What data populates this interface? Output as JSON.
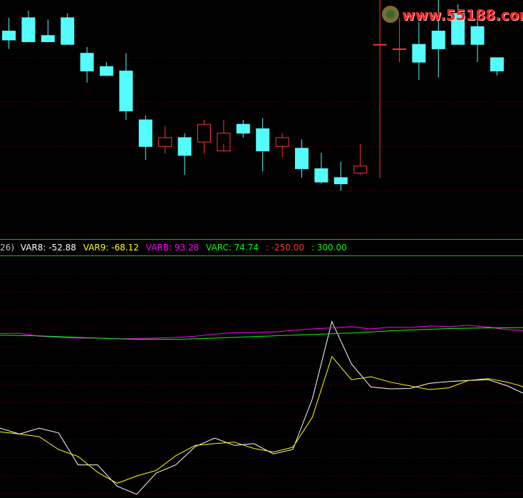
{
  "colors": {
    "background": "#000000",
    "up_candle": "#ff3232",
    "down_candle": "#54fcfc",
    "grid": "#800000",
    "separator": "#00c800",
    "var8": "#ffffff",
    "var9": "#ffff00",
    "varb": "#ff00ff",
    "varc": "#00ff00",
    "level_low": "#ff3232",
    "level_high": "#00ff00"
  },
  "watermark": {
    "text": "www.55188.com",
    "icon": "logo-circle-icon"
  },
  "indicator_bar": {
    "prefix": "26)",
    "var8": "VAR8: -52.88",
    "var9": "VAR9: -68.12",
    "varb": "VARB: 93.28",
    "varc": "VARC: 74.74",
    "level_low": ": -250.00",
    "level_high": ": 300.00"
  },
  "chart_data": [
    {
      "type": "candlestick",
      "title": "",
      "x": [
        0,
        1,
        2,
        3,
        4,
        5,
        6,
        7,
        8,
        9,
        10,
        11,
        12,
        13,
        14,
        15,
        16,
        17,
        18,
        19,
        20,
        21,
        22,
        23,
        24,
        25
      ],
      "open": [
        98,
        99.5,
        97.5,
        99.5,
        95.5,
        94,
        93.5,
        88,
        85,
        86,
        85.5,
        84.5,
        87.5,
        87,
        85,
        84.8,
        82.5,
        81.5,
        82,
        96.5,
        96,
        96.5,
        98,
        100,
        98.5,
        95
      ],
      "high": [
        99.5,
        100.3,
        99.3,
        100,
        96.2,
        94.5,
        95.5,
        88.5,
        87.3,
        86.5,
        88,
        88,
        88,
        88.2,
        86.5,
        85.8,
        84.3,
        83.3,
        85.3,
        102,
        99.5,
        99,
        101.5,
        101,
        100,
        95
      ],
      "low": [
        96,
        96.8,
        96.8,
        96.5,
        92.2,
        93,
        88,
        83.5,
        84.2,
        81.8,
        84.2,
        85.3,
        86,
        82.2,
        83.8,
        81.5,
        80.8,
        80,
        81.8,
        81.4,
        94.5,
        92.5,
        92.8,
        97,
        94.5,
        93
      ],
      "close": [
        97,
        96.8,
        96.8,
        96.5,
        93.5,
        93,
        89,
        85,
        86,
        84,
        87.5,
        86.5,
        86.5,
        84.5,
        86,
        82.5,
        81,
        80.8,
        82.8,
        96.5,
        96,
        94.5,
        96,
        96.5,
        96.5,
        93.5
      ]
    },
    {
      "type": "line",
      "title": "",
      "x": [
        0,
        1,
        2,
        3,
        4,
        5,
        6,
        7,
        8,
        9,
        10,
        11,
        12,
        13,
        14,
        15,
        16,
        17,
        18,
        19,
        20,
        21,
        22,
        23,
        24,
        25,
        26,
        27,
        28
      ],
      "series": [
        {
          "name": "VAR8",
          "values": [
            -170,
            -186,
            -170,
            -183,
            -270,
            -270,
            -328,
            -350,
            -292,
            -270,
            -220,
            -197,
            -217,
            -212,
            -240,
            -228,
            -90,
            120,
            5,
            -58,
            -63,
            -62,
            -48,
            -43,
            -40,
            -38,
            -55,
            -80,
            -90
          ]
        },
        {
          "name": "VAR9",
          "values": [
            -180,
            -186,
            -193,
            -228,
            -247,
            -290,
            -320,
            -300,
            -285,
            -245,
            -217,
            -212,
            -208,
            -225,
            -235,
            -222,
            -140,
            25,
            -38,
            -30,
            -45,
            -55,
            -65,
            -60,
            -40,
            -35,
            -45,
            -60,
            -75
          ]
        },
        {
          "name": "VARB",
          "values": [
            88,
            88,
            80,
            77,
            75,
            75,
            73,
            74,
            75,
            77,
            80,
            86,
            90,
            91,
            92,
            96,
            100,
            103,
            106,
            100,
            105,
            104,
            108,
            106,
            110,
            105,
            98,
            95,
            93
          ]
        },
        {
          "name": "VARC",
          "values": [
            83,
            82,
            81,
            79,
            77,
            75,
            73,
            72,
            72,
            72,
            73,
            75,
            77,
            79,
            81,
            83,
            85,
            87,
            89,
            92,
            95,
            97,
            99,
            101,
            102,
            103,
            103,
            104,
            105
          ]
        }
      ],
      "levels": [
        {
          "label": "-250.00",
          "value": -250
        },
        {
          "label": "300.00",
          "value": 300
        }
      ]
    }
  ]
}
